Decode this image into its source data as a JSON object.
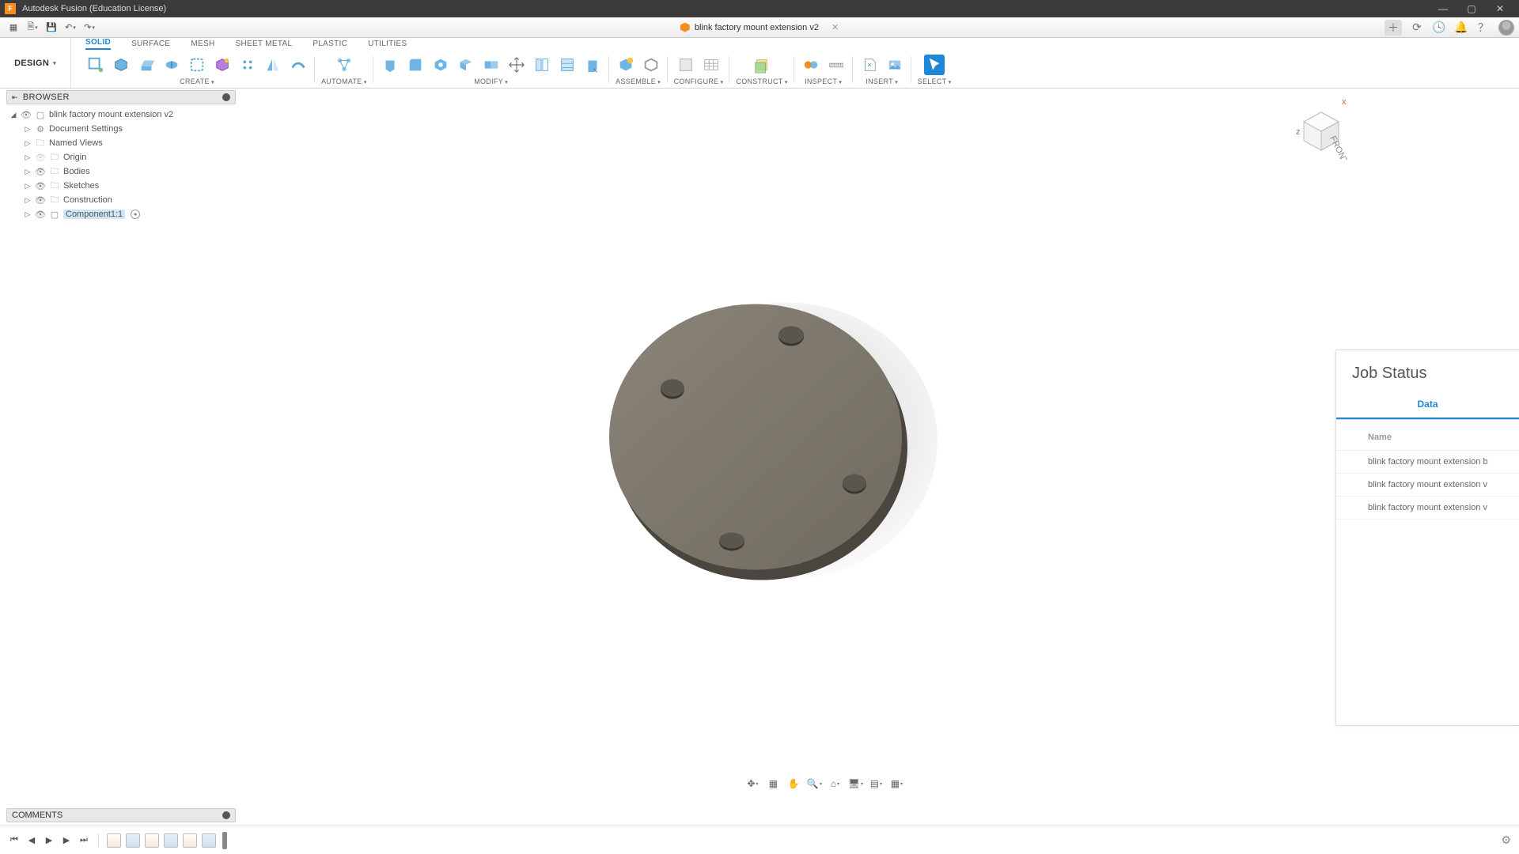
{
  "window": {
    "title": "Autodesk Fusion (Education License)"
  },
  "document": {
    "name": "blink factory mount extension v2"
  },
  "ribbon": {
    "workspace": "DESIGN",
    "tabs": [
      "SOLID",
      "SURFACE",
      "MESH",
      "SHEET METAL",
      "PLASTIC",
      "UTILITIES"
    ],
    "active_tab": "SOLID",
    "groups": {
      "create": "CREATE",
      "automate": "AUTOMATE",
      "modify": "MODIFY",
      "assemble": "ASSEMBLE",
      "configure": "CONFIGURE",
      "construct": "CONSTRUCT",
      "inspect": "INSPECT",
      "insert": "INSERT",
      "select": "SELECT"
    }
  },
  "browser": {
    "title": "BROWSER",
    "root": "blink factory mount extension v2",
    "nodes": [
      {
        "name": "Document Settings",
        "icon": "gear"
      },
      {
        "name": "Named Views",
        "icon": "folder"
      },
      {
        "name": "Origin",
        "icon": "folder",
        "dim": true
      },
      {
        "name": "Bodies",
        "icon": "folder"
      },
      {
        "name": "Sketches",
        "icon": "folder"
      },
      {
        "name": "Construction",
        "icon": "folder"
      },
      {
        "name": "Component1:1",
        "icon": "component",
        "selected": true,
        "badge": true
      }
    ]
  },
  "viewcube": {
    "face": "FRONT"
  },
  "job_panel": {
    "title": "Job Status",
    "tab": "Data",
    "col": "Name",
    "rows": [
      "blink factory mount extension b",
      "blink factory mount extension v",
      "blink factory mount extension v"
    ]
  },
  "comments": {
    "title": "COMMENTS"
  }
}
